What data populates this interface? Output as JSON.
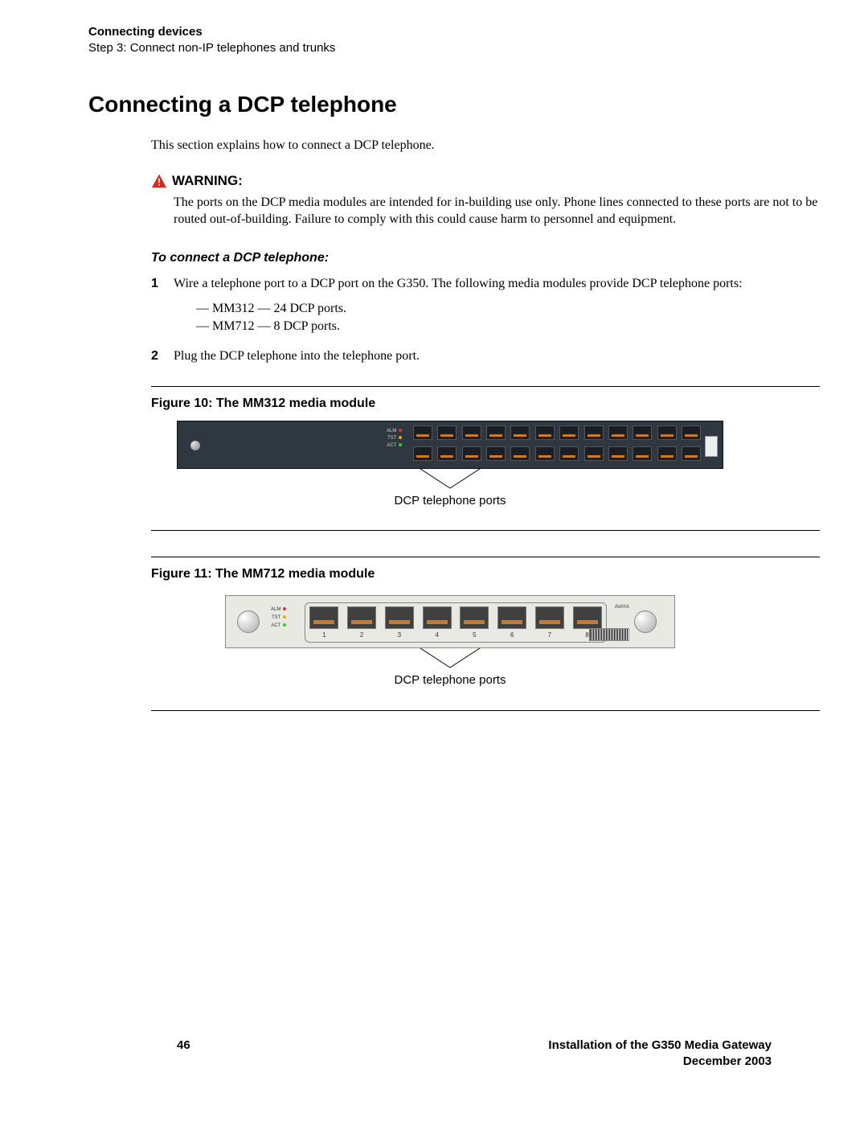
{
  "header": {
    "section": "Connecting devices",
    "step": "Step 3: Connect non-IP telephones and trunks"
  },
  "title": "Connecting a DCP telephone",
  "intro": "This section explains how to connect a DCP telephone.",
  "warning": {
    "label": "WARNING:",
    "body": "The ports on the DCP media modules are intended for in-building use only. Phone lines connected to these ports are not to be routed out-of-building.  Failure to comply with this could cause harm to personnel and equipment."
  },
  "subheading": "To connect a DCP telephone:",
  "steps": [
    {
      "no": "1",
      "text": "Wire a telephone port to a DCP port on the G350. The following media modules provide DCP telephone ports:",
      "bullets": [
        "MM312 — 24 DCP ports.",
        "MM712 — 8 DCP ports."
      ]
    },
    {
      "no": "2",
      "text": "Plug the DCP telephone into the telephone port."
    }
  ],
  "figures": {
    "fig10": {
      "title": "Figure 10: The MM312 media module",
      "callout": "DCP telephone ports",
      "leds": [
        "ALM",
        "TST",
        "ACT"
      ]
    },
    "fig11": {
      "title": "Figure 11: The MM712 media module",
      "callout": "DCP telephone ports",
      "leds": [
        "ALM",
        "TST",
        "ACT"
      ],
      "port_numbers": [
        "1",
        "2",
        "3",
        "4",
        "5",
        "6",
        "7",
        "8"
      ],
      "branding": "AVAYA"
    }
  },
  "footer": {
    "page": "46",
    "doc": "Installation of the G350 Media Gateway",
    "date": "December 2003"
  }
}
